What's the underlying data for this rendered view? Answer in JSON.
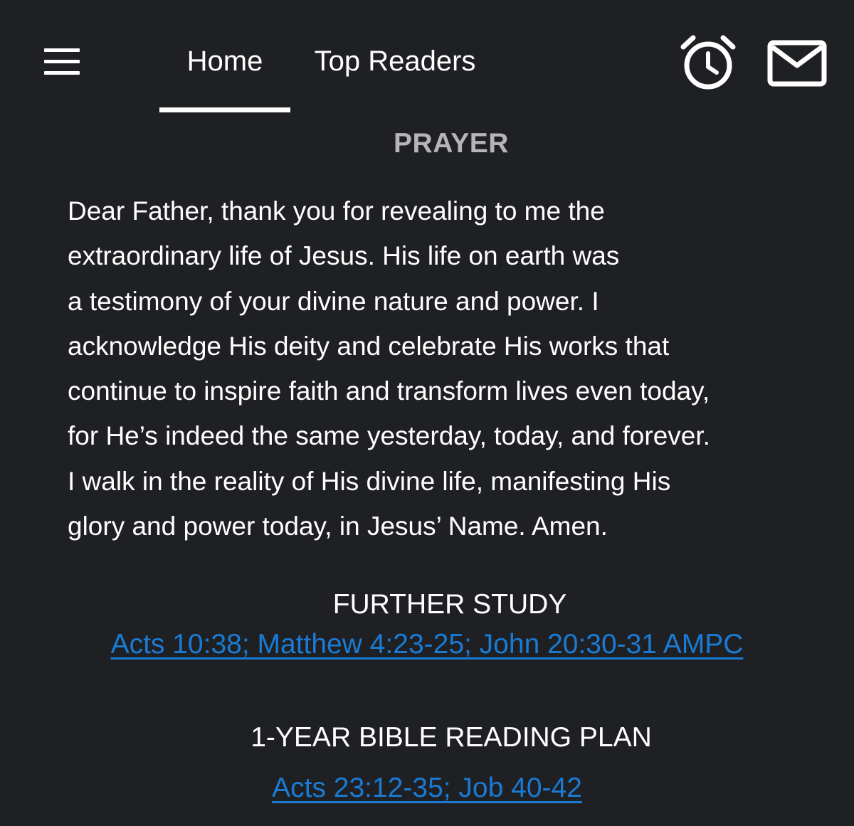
{
  "nav": {
    "menu_icon": "hamburger-menu-icon",
    "tabs": [
      {
        "label": "Home",
        "active": true
      },
      {
        "label": "Top Readers",
        "active": false
      }
    ],
    "alarm_icon": "alarm-clock-icon",
    "mail_icon": "mail-envelope-icon"
  },
  "prayer": {
    "title": "PRAYER",
    "lines": [
      "Dear Father, thank you for revealing to me the",
      "extraordinary life of Jesus. His life on earth was",
      "a testimony of your divine nature and power. I",
      "acknowledge His deity and celebrate His works that",
      "continue to inspire faith and transform lives even today,",
      "for He’s indeed the same yesterday, today, and forever.",
      "I walk in the reality of His divine life, manifesting His",
      "glory and power today, in Jesus’ Name. Amen."
    ]
  },
  "further_study": {
    "title": "FURTHER STUDY",
    "link": "Acts 10:38; Matthew 4:23-25; John 20:30-31 AMPC"
  },
  "reading_plan": {
    "title": "1-YEAR BIBLE READING PLAN",
    "link": "Acts 23:12-35; Job 40-42"
  },
  "colors": {
    "background": "#1f2023",
    "text": "#ffffff",
    "muted_heading": "#b5b5b8",
    "link": "#1a7bd4"
  }
}
